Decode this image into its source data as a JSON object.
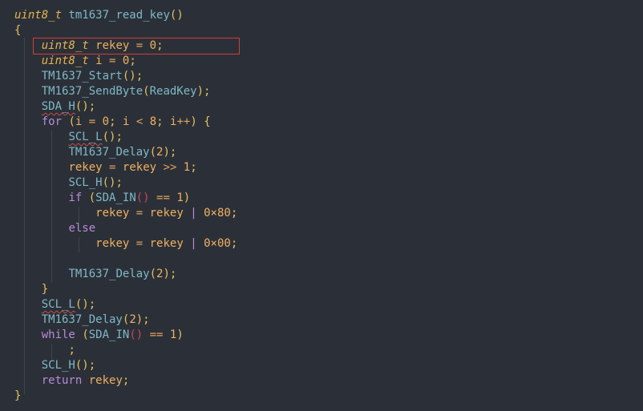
{
  "code": {
    "lines": [
      {
        "tokens": [
          [
            "kw-type",
            "uint8_t"
          ],
          [
            "plain",
            " "
          ],
          [
            "fn",
            "tm1637_read_key"
          ],
          [
            "punc",
            "()"
          ]
        ]
      },
      {
        "tokens": [
          [
            "brace",
            "{"
          ]
        ]
      },
      {
        "tokens": [
          [
            "plain",
            "    "
          ],
          [
            "kw-type",
            "uint8_t"
          ],
          [
            "plain",
            " "
          ],
          [
            "var",
            "rekey"
          ],
          [
            "plain",
            " "
          ],
          [
            "op",
            "="
          ],
          [
            "plain",
            " "
          ],
          [
            "num",
            "0"
          ],
          [
            "punc",
            ";"
          ]
        ]
      },
      {
        "tokens": [
          [
            "plain",
            "    "
          ],
          [
            "kw-type",
            "uint8_t"
          ],
          [
            "plain",
            " "
          ],
          [
            "var",
            "i"
          ],
          [
            "plain",
            " "
          ],
          [
            "op",
            "="
          ],
          [
            "plain",
            " "
          ],
          [
            "num",
            "0"
          ],
          [
            "punc",
            ";"
          ]
        ]
      },
      {
        "tokens": [
          [
            "plain",
            "    "
          ],
          [
            "fn",
            "TM1637_Start"
          ],
          [
            "punc",
            "();"
          ]
        ]
      },
      {
        "tokens": [
          [
            "plain",
            "    "
          ],
          [
            "fn",
            "TM1637_SendByte"
          ],
          [
            "punc",
            "("
          ],
          [
            "fn",
            "ReadKey"
          ],
          [
            "punc",
            ");"
          ]
        ]
      },
      {
        "tokens": [
          [
            "plain",
            "    "
          ],
          [
            "fn squig",
            "SDA_H"
          ],
          [
            "punc",
            "();"
          ]
        ]
      },
      {
        "tokens": [
          [
            "plain",
            "    "
          ],
          [
            "kw",
            "for"
          ],
          [
            "plain",
            " "
          ],
          [
            "punc",
            "("
          ],
          [
            "var",
            "i"
          ],
          [
            "plain",
            " "
          ],
          [
            "op",
            "="
          ],
          [
            "plain",
            " "
          ],
          [
            "num",
            "0"
          ],
          [
            "punc",
            ";"
          ],
          [
            "plain",
            " "
          ],
          [
            "var",
            "i"
          ],
          [
            "plain",
            " "
          ],
          [
            "op",
            "<"
          ],
          [
            "plain",
            " "
          ],
          [
            "num",
            "8"
          ],
          [
            "punc",
            ";"
          ],
          [
            "plain",
            " "
          ],
          [
            "var",
            "i"
          ],
          [
            "op",
            "++"
          ],
          [
            "punc",
            ")"
          ],
          [
            "plain",
            " "
          ],
          [
            "brace",
            "{"
          ]
        ]
      },
      {
        "tokens": [
          [
            "plain",
            "        "
          ],
          [
            "fn squig",
            "SCL_L"
          ],
          [
            "punc",
            "();"
          ]
        ]
      },
      {
        "tokens": [
          [
            "plain",
            "        "
          ],
          [
            "fn",
            "TM1637_Delay"
          ],
          [
            "punc",
            "("
          ],
          [
            "num",
            "2"
          ],
          [
            "punc",
            ");"
          ]
        ]
      },
      {
        "tokens": [
          [
            "plain",
            "        "
          ],
          [
            "var",
            "rekey"
          ],
          [
            "plain",
            " "
          ],
          [
            "op",
            "="
          ],
          [
            "plain",
            " "
          ],
          [
            "var",
            "rekey"
          ],
          [
            "plain",
            " "
          ],
          [
            "op",
            ">>"
          ],
          [
            "plain",
            " "
          ],
          [
            "num",
            "1"
          ],
          [
            "punc",
            ";"
          ]
        ]
      },
      {
        "tokens": [
          [
            "plain",
            "        "
          ],
          [
            "fn",
            "SCL_H"
          ],
          [
            "punc",
            "();"
          ]
        ]
      },
      {
        "tokens": [
          [
            "plain",
            "        "
          ],
          [
            "kw",
            "if"
          ],
          [
            "plain",
            " "
          ],
          [
            "punc",
            "("
          ],
          [
            "fn",
            "SDA_IN"
          ],
          [
            "paren-hl",
            "()"
          ],
          [
            "plain",
            " "
          ],
          [
            "op",
            "=="
          ],
          [
            "plain",
            " "
          ],
          [
            "num",
            "1"
          ],
          [
            "punc",
            ")"
          ]
        ]
      },
      {
        "tokens": [
          [
            "plain",
            "            "
          ],
          [
            "var",
            "rekey"
          ],
          [
            "plain",
            " "
          ],
          [
            "op",
            "="
          ],
          [
            "plain",
            " "
          ],
          [
            "var",
            "rekey"
          ],
          [
            "plain",
            " "
          ],
          [
            "kw",
            "|"
          ],
          [
            "plain",
            " "
          ],
          [
            "hex",
            "0×80"
          ],
          [
            "punc",
            ";"
          ]
        ]
      },
      {
        "tokens": [
          [
            "plain",
            "        "
          ],
          [
            "kw",
            "else"
          ]
        ]
      },
      {
        "tokens": [
          [
            "plain",
            "            "
          ],
          [
            "var",
            "rekey"
          ],
          [
            "plain",
            " "
          ],
          [
            "op",
            "="
          ],
          [
            "plain",
            " "
          ],
          [
            "var",
            "rekey"
          ],
          [
            "plain",
            " "
          ],
          [
            "kw",
            "|"
          ],
          [
            "plain",
            " "
          ],
          [
            "hex",
            "0×00"
          ],
          [
            "punc",
            ";"
          ]
        ]
      },
      {
        "tokens": [
          [
            "plain",
            ""
          ]
        ]
      },
      {
        "tokens": [
          [
            "plain",
            "        "
          ],
          [
            "fn",
            "TM1637_Delay"
          ],
          [
            "punc",
            "("
          ],
          [
            "num",
            "2"
          ],
          [
            "punc",
            ");"
          ]
        ]
      },
      {
        "tokens": [
          [
            "plain",
            "    "
          ],
          [
            "brace",
            "}"
          ]
        ]
      },
      {
        "tokens": [
          [
            "plain",
            "    "
          ],
          [
            "fn squig",
            "SCL_L"
          ],
          [
            "punc",
            "();"
          ]
        ]
      },
      {
        "tokens": [
          [
            "plain",
            "    "
          ],
          [
            "fn",
            "TM1637_Delay"
          ],
          [
            "punc",
            "("
          ],
          [
            "num",
            "2"
          ],
          [
            "punc",
            ");"
          ]
        ]
      },
      {
        "tokens": [
          [
            "plain",
            "    "
          ],
          [
            "kw",
            "while"
          ],
          [
            "plain",
            " "
          ],
          [
            "punc",
            "("
          ],
          [
            "fn",
            "SDA_IN"
          ],
          [
            "paren-hl",
            "()"
          ],
          [
            "plain",
            " "
          ],
          [
            "op",
            "=="
          ],
          [
            "plain",
            " "
          ],
          [
            "num",
            "1"
          ],
          [
            "punc",
            ")"
          ]
        ]
      },
      {
        "tokens": [
          [
            "plain",
            "        "
          ],
          [
            "punc",
            ";"
          ]
        ]
      },
      {
        "tokens": [
          [
            "plain",
            "    "
          ],
          [
            "fn",
            "SCL_H"
          ],
          [
            "punc",
            "();"
          ]
        ]
      },
      {
        "tokens": [
          [
            "plain",
            "    "
          ],
          [
            "kw",
            "return"
          ],
          [
            "plain",
            " "
          ],
          [
            "var",
            "rekey"
          ],
          [
            "punc",
            ";"
          ]
        ]
      },
      {
        "tokens": [
          [
            "brace",
            "}"
          ]
        ]
      }
    ]
  },
  "colors": {
    "background": "#2b3038",
    "highlight_box": "#d23c3c"
  }
}
